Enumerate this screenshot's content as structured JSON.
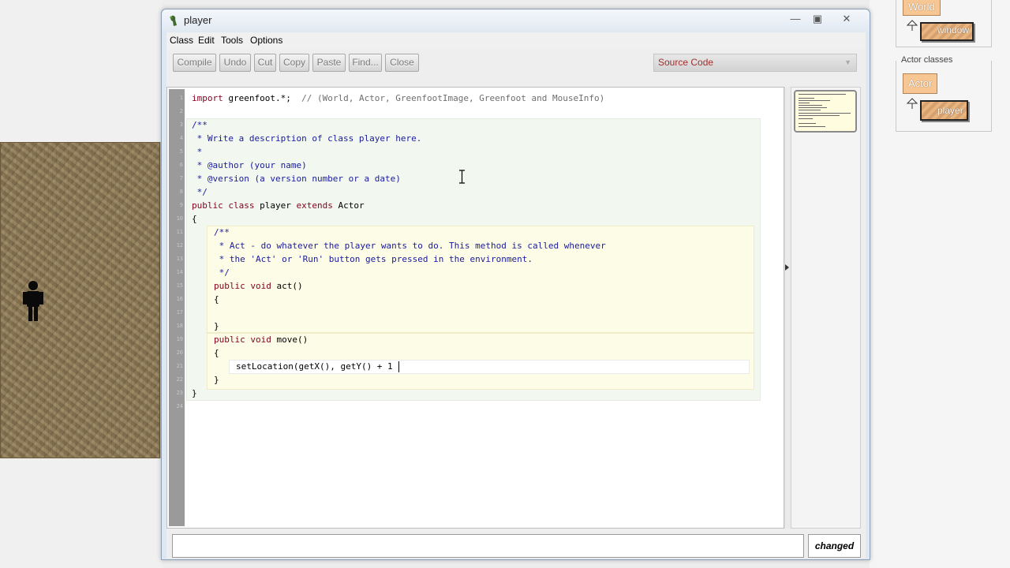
{
  "window": {
    "title": "player",
    "minimize_icon": "minimize-icon",
    "maximize_icon": "maximize-icon",
    "close_icon": "close-icon"
  },
  "menu": [
    "Class",
    "Edit",
    "Tools",
    "Options"
  ],
  "toolbar": {
    "buttons": [
      "Compile",
      "Undo",
      "Cut",
      "Copy",
      "Paste",
      "Find...",
      "Close"
    ],
    "view_select": "Source Code"
  },
  "code": {
    "line_numbers": [
      "1",
      "2",
      "3",
      "4",
      "5",
      "6",
      "7",
      "8",
      "9",
      "10",
      "11",
      "12",
      "13",
      "14",
      "15",
      "16",
      "17",
      "18",
      "19",
      "20",
      "21",
      "22",
      "23",
      "24"
    ],
    "import_kw": "import",
    "import_rest": " greenfoot.*;  ",
    "import_comment": "// (World, Actor, GreenfootImage, Greenfoot and MouseInfo)",
    "doc1": "/**",
    "doc2": " * Write a description of class player here.",
    "doc3": " * ",
    "doc4": " * @author (your name)",
    "doc5": " * @version (a version number or a date)",
    "doc6": " */",
    "class_kw1": "public",
    "class_kw2": "class",
    "class_name": "player",
    "class_kw3": "extends",
    "class_super": "Actor",
    "open_brace": "{",
    "mdoc1": "/**",
    "mdoc2": " * Act - do whatever the player wants to do. This method is called whenever",
    "mdoc3": " * the 'Act' or 'Run' button gets pressed in the environment.",
    "mdoc4": " */",
    "act_kw1": "public",
    "act_kw2": "void",
    "act_sig": "act()",
    "act_open": "{",
    "act_close": "}",
    "move_kw1": "public",
    "move_kw2": "void",
    "move_sig": "move()",
    "move_open": "{",
    "move_body": "setLocation(getX(), getY() + 1",
    "move_close": "}",
    "close_brace": "}"
  },
  "status": {
    "message": "",
    "badge": "changed"
  },
  "class_diagram": {
    "world_class": "World",
    "world_sub": "window",
    "section_label": "Actor classes",
    "actor_class": "Actor",
    "actor_sub": "player"
  },
  "colors": {
    "keyword": "#84001e",
    "comment": "#6e6e6e",
    "doc": "#1a1a9a",
    "class_scope": "#f2f8f0",
    "method_scope": "#fdfce6"
  }
}
